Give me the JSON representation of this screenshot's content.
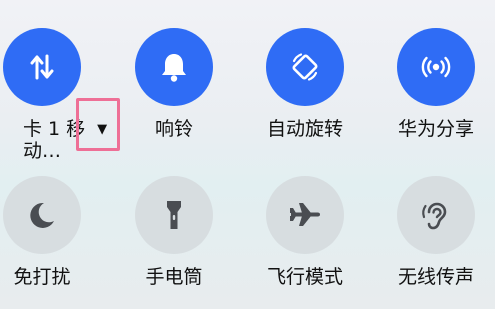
{
  "accent_color": "#2f6cf5",
  "inactive_color": "#d7dde0",
  "highlight_color": "#ee6f96",
  "tiles": [
    {
      "label": "卡 1 移",
      "label_line2": "动…",
      "icon": "mobile-data-icon",
      "active": true,
      "has_dropdown": true,
      "dropdown_glyph": "▼"
    },
    {
      "label": "响铃",
      "icon": "bell-icon",
      "active": true
    },
    {
      "label": "自动旋转",
      "icon": "auto-rotate-icon",
      "active": true
    },
    {
      "label": "华为分享",
      "icon": "huawei-share-icon",
      "active": true
    },
    {
      "label": "免打扰",
      "icon": "moon-icon",
      "active": false
    },
    {
      "label": "手电筒",
      "icon": "flashlight-icon",
      "active": false
    },
    {
      "label": "飞行模式",
      "icon": "airplane-icon",
      "active": false
    },
    {
      "label": "无线传声",
      "icon": "hearing-icon",
      "active": false
    }
  ]
}
